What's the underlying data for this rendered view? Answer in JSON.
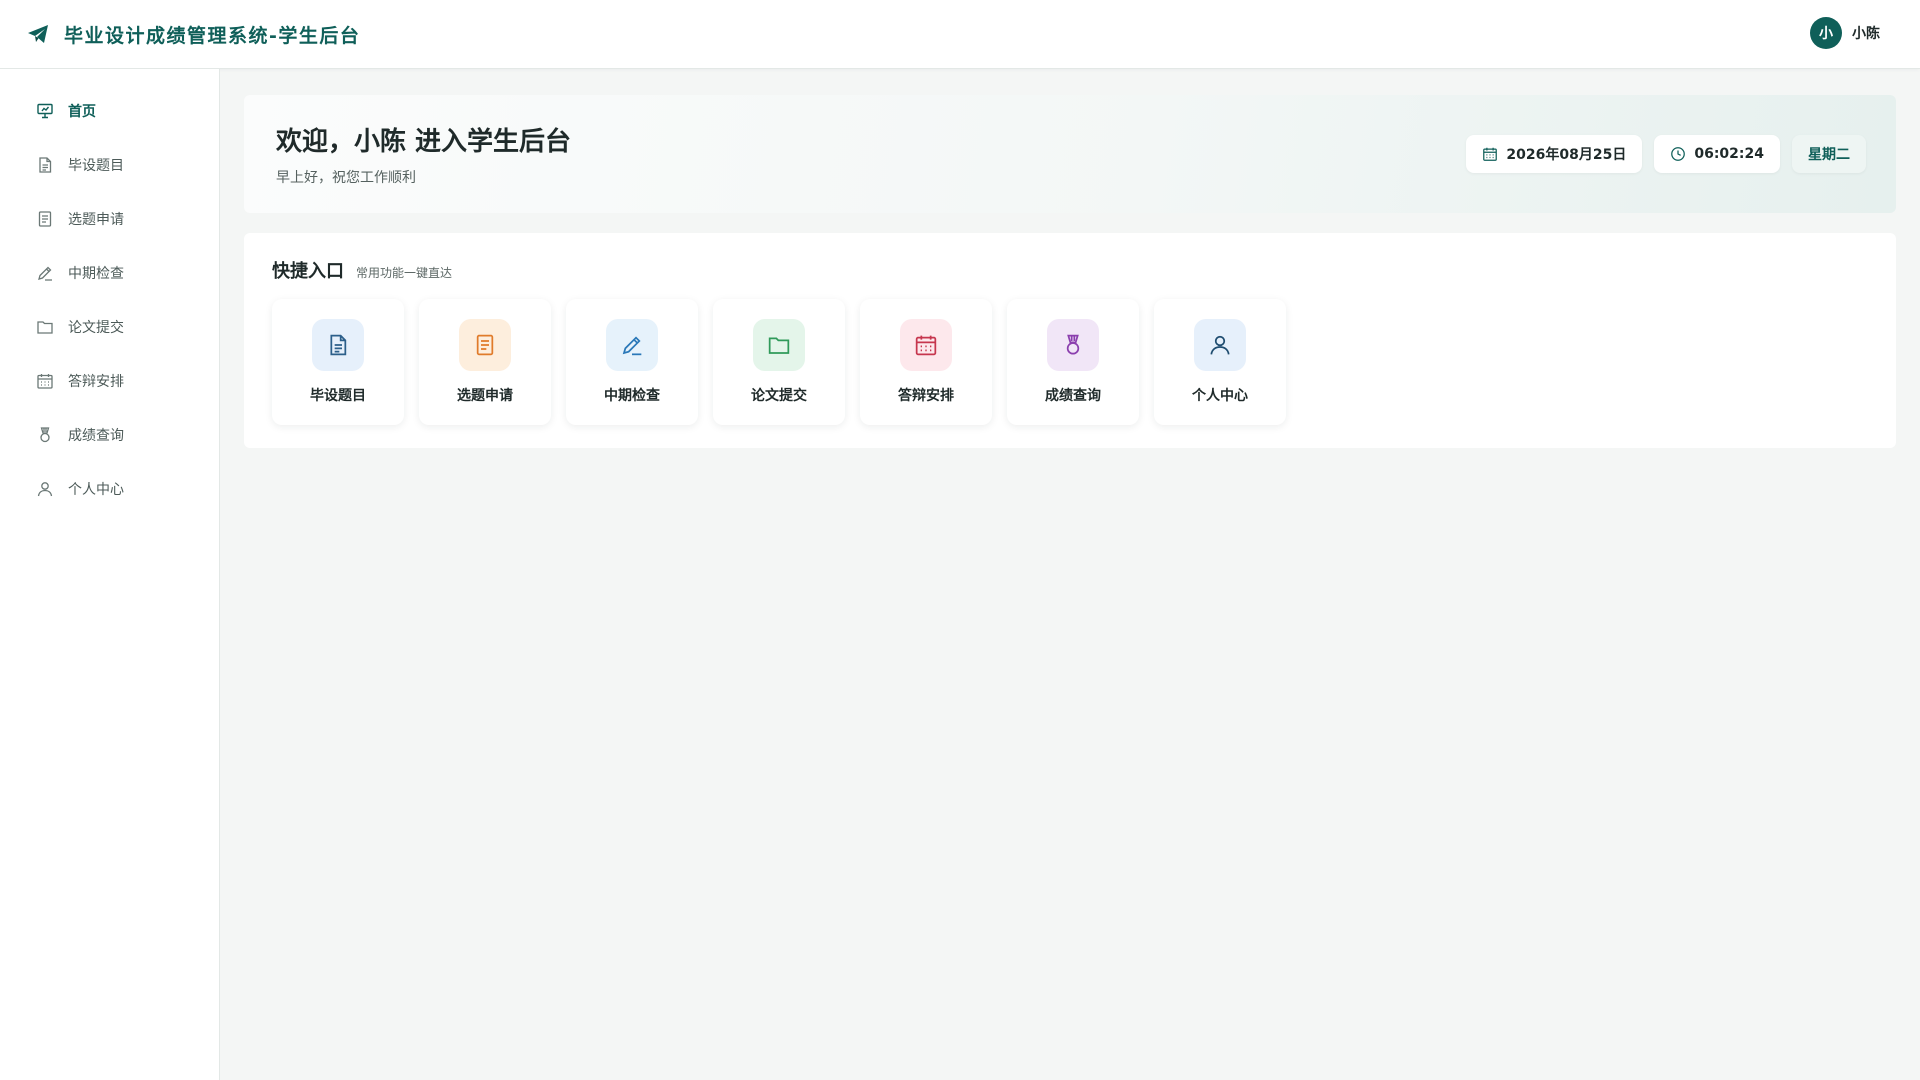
{
  "header": {
    "title": "毕业设计成绩管理系统-学生后台",
    "brand_icon": "paper-plane-icon",
    "user": {
      "avatar_text": "小",
      "name": "小陈"
    }
  },
  "sidebar": {
    "items": [
      {
        "label": "首页",
        "icon": "home-icon",
        "active": true
      },
      {
        "label": "毕设题目",
        "icon": "document-icon"
      },
      {
        "label": "选题申请",
        "icon": "form-icon"
      },
      {
        "label": "中期检查",
        "icon": "pen-icon"
      },
      {
        "label": "论文提交",
        "icon": "folder-icon"
      },
      {
        "label": "答辩安排",
        "icon": "calendar-icon"
      },
      {
        "label": "成绩查询",
        "icon": "medal-icon"
      },
      {
        "label": "个人中心",
        "icon": "user-icon"
      }
    ]
  },
  "welcome": {
    "title": "欢迎，小陈 进入学生后台",
    "subtitle": "早上好，祝您工作顺利",
    "date": "2026年08月25日",
    "time": "06:02:24",
    "weekday": "星期二"
  },
  "quick": {
    "title": "快捷入口",
    "desc": "常用功能一键直达",
    "tiles": [
      {
        "label": "毕设题目",
        "icon": "document-icon",
        "bg": "#e6f0fb",
        "color": "#2c5f8a"
      },
      {
        "label": "选题申请",
        "icon": "form-icon",
        "bg": "#fdeedd",
        "color": "#e07b2a"
      },
      {
        "label": "中期检查",
        "icon": "pen-icon",
        "bg": "#e6f2fb",
        "color": "#2a78b8"
      },
      {
        "label": "论文提交",
        "icon": "folder-icon",
        "bg": "#e4f5ea",
        "color": "#2f9a5a"
      },
      {
        "label": "答辩安排",
        "icon": "calendar-icon",
        "bg": "#fde8ec",
        "color": "#c6364e"
      },
      {
        "label": "成绩查询",
        "icon": "medal-icon",
        "bg": "#f1e6f7",
        "color": "#8b3fae"
      },
      {
        "label": "个人中心",
        "icon": "user-icon",
        "bg": "#e6f0fb",
        "color": "#1f4d70"
      }
    ]
  },
  "colors": {
    "accent": "#0f5f59",
    "nav_icon": "#6b7876",
    "background": "#f4f6f5"
  }
}
